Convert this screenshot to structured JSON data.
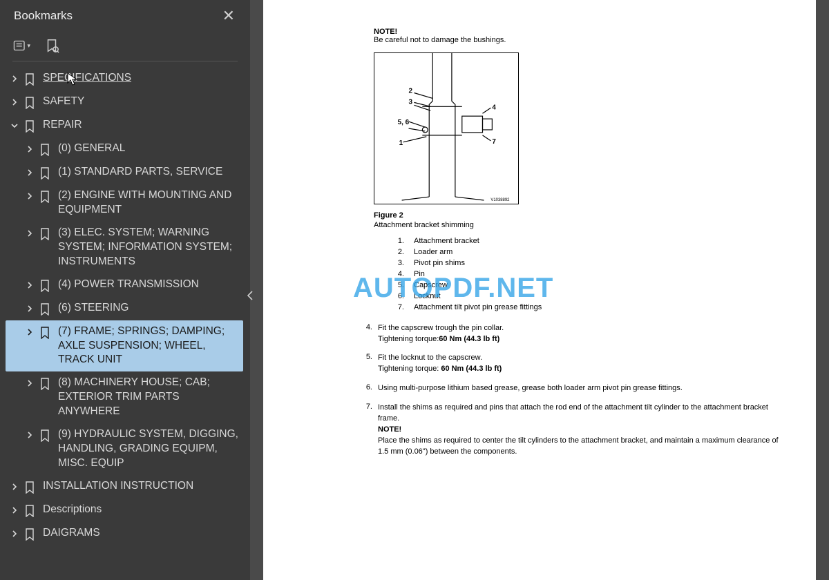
{
  "sidebar": {
    "title": "Bookmarks",
    "items": [
      {
        "label": "SPECIFICATIONS",
        "level": 0,
        "expanded": false,
        "underline": true
      },
      {
        "label": "SAFETY",
        "level": 0,
        "expanded": false
      },
      {
        "label": "REPAIR",
        "level": 0,
        "expanded": true
      },
      {
        "label": "(0) GENERAL",
        "level": 1,
        "expanded": false
      },
      {
        "label": "(1) STANDARD PARTS, SERVICE",
        "level": 1,
        "expanded": false
      },
      {
        "label": "(2) ENGINE WITH MOUNTING AND EQUIPMENT",
        "level": 1,
        "expanded": false
      },
      {
        "label": "(3) ELEC. SYSTEM; WARNING SYSTEM; INFORMATION SYSTEM; INSTRUMENTS",
        "level": 1,
        "expanded": false
      },
      {
        "label": "(4) POWER TRANSMISSION",
        "level": 1,
        "expanded": false
      },
      {
        "label": "(6) STEERING",
        "level": 1,
        "expanded": false
      },
      {
        "label": "(7) FRAME; SPRINGS; DAMPING; AXLE SUSPENSION; WHEEL, TRACK UNIT",
        "level": 1,
        "expanded": false,
        "selected": true
      },
      {
        "label": "(8) MACHINERY HOUSE; CAB; EXTERIOR TRIM PARTS ANYWHERE",
        "level": 1,
        "expanded": false
      },
      {
        "label": "(9) HYDRAULIC SYSTEM, DIGGING, HANDLING, GRADING EQUIPM, MISC. EQUIP",
        "level": 1,
        "expanded": false
      },
      {
        "label": "INSTALLATION INSTRUCTION",
        "level": 0,
        "expanded": false
      },
      {
        "label": "Descriptions",
        "level": 0,
        "expanded": false
      },
      {
        "label": "DAIGRAMS",
        "level": 0,
        "expanded": false
      }
    ]
  },
  "doc": {
    "note_label": "NOTE!",
    "note_text": "Be careful not to damage the bushings.",
    "figure_id_small": "V1038892",
    "figure_label": "Figure 2",
    "figure_caption": "Attachment bracket shimming",
    "callouts": {
      "c1": "1",
      "c2": "2",
      "c3": "3",
      "c4": "4",
      "c56": "5, 6",
      "c7": "7"
    },
    "parts": [
      {
        "n": "1.",
        "t": "Attachment bracket"
      },
      {
        "n": "2.",
        "t": "Loader arm"
      },
      {
        "n": "3.",
        "t": "Pivot pin shims"
      },
      {
        "n": "4.",
        "t": "Pin"
      },
      {
        "n": "5.",
        "t": "Capscrew"
      },
      {
        "n": "6.",
        "t": "Locknut"
      },
      {
        "n": "7.",
        "t": "Attachment tilt pivot pin grease fittings"
      }
    ],
    "steps": [
      {
        "n": "4.",
        "lines": [
          "Fit the capscrew trough the pin collar.",
          "Tightening torque:60 Nm (44.3 lb ft)"
        ],
        "bold_tail": true
      },
      {
        "n": "5.",
        "lines": [
          "Fit the locknut to the capscrew.",
          "Tightening torque: 60 Nm (44.3 lb ft)"
        ],
        "bold_tail": true
      },
      {
        "n": "6.",
        "lines": [
          "Using multi-purpose lithium based grease, grease both loader arm pivot pin grease fittings."
        ]
      },
      {
        "n": "7.",
        "lines": [
          "Install the shims as required and pins that attach the rod end of the attachment tilt cylinder to the attachment bracket frame.",
          "NOTE!",
          "Place the shims as required to center the tilt cylinders to the attachment bracket, and maintain a maximum clearance of 1.5 mm (0.06\") between the components."
        ],
        "note_at": 1
      }
    ],
    "watermark": "AUTOPDF.NET"
  }
}
